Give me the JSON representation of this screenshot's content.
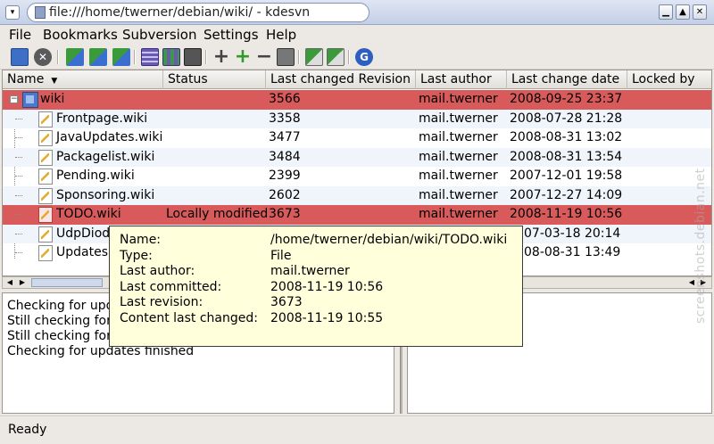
{
  "window": {
    "title": "file:///home/twerner/debian/wiki/ - kdesvn"
  },
  "menu": [
    "File",
    "Bookmarks",
    "Subversion",
    "Settings",
    "Help"
  ],
  "toolbar": {
    "icons": [
      "open-folder-icon",
      "close-icon",
      "update-icon",
      "commit-icon",
      "diff-icon",
      "log-icon",
      "blame-icon",
      "info-icon",
      "add-icon",
      "add-recursive-icon",
      "delete-icon",
      "revert-icon",
      "checkout-icon",
      "export-icon",
      "refresh-icon"
    ]
  },
  "columns": [
    "Name",
    "Status",
    "Last changed Revision",
    "Last author",
    "Last change date",
    "Locked by"
  ],
  "rows": [
    {
      "name": "wiki",
      "status": "",
      "revision": "3566",
      "author": "mail.twerner",
      "date": "2008-09-25 23:37",
      "locked": "",
      "type": "dir",
      "highlight": true
    },
    {
      "name": "Frontpage.wiki",
      "status": "",
      "revision": "3358",
      "author": "mail.twerner",
      "date": "2008-07-28 21:28",
      "locked": "",
      "type": "file",
      "highlight": false
    },
    {
      "name": "JavaUpdates.wiki",
      "status": "",
      "revision": "3477",
      "author": "mail.twerner",
      "date": "2008-08-31 13:02",
      "locked": "",
      "type": "file",
      "highlight": false
    },
    {
      "name": "Packagelist.wiki",
      "status": "",
      "revision": "3484",
      "author": "mail.twerner",
      "date": "2008-08-31 13:54",
      "locked": "",
      "type": "file",
      "highlight": false
    },
    {
      "name": "Pending.wiki",
      "status": "",
      "revision": "2399",
      "author": "mail.twerner",
      "date": "2007-12-01 19:58",
      "locked": "",
      "type": "file",
      "highlight": false
    },
    {
      "name": "Sponsoring.wiki",
      "status": "",
      "revision": "2602",
      "author": "mail.twerner",
      "date": "2007-12-27 14:09",
      "locked": "",
      "type": "file",
      "highlight": false
    },
    {
      "name": "TODO.wiki",
      "status": "Locally modified",
      "revision": "3673",
      "author": "mail.twerner",
      "date": "2008-11-19 10:56",
      "locked": "",
      "type": "file-modified",
      "highlight": true
    },
    {
      "name": "UdpDiode",
      "status": "",
      "revision": "",
      "author": "",
      "date": "07-03-18 20:14",
      "locked": "",
      "type": "file",
      "highlight": false
    },
    {
      "name": "Updates.",
      "status": "",
      "revision": "",
      "author": "",
      "date": "08-08-31 13:49",
      "locked": "",
      "type": "file",
      "highlight": false
    }
  ],
  "log": [
    "Checking for upda",
    "Still checking for",
    "Still checking for",
    "Checking for updates finished"
  ],
  "status": "Ready",
  "tooltip": {
    "labels": [
      "Name:",
      "Type:",
      "Last author:",
      "Last committed:",
      "Last revision:",
      "Content last changed:"
    ],
    "values": [
      "/home/twerner/debian/wiki/TODO.wiki",
      "File",
      "mail.twerner",
      "2008-11-19 10:56",
      "3673",
      "2008-11-19 10:55"
    ]
  },
  "watermark": "screenshots.debian.net"
}
